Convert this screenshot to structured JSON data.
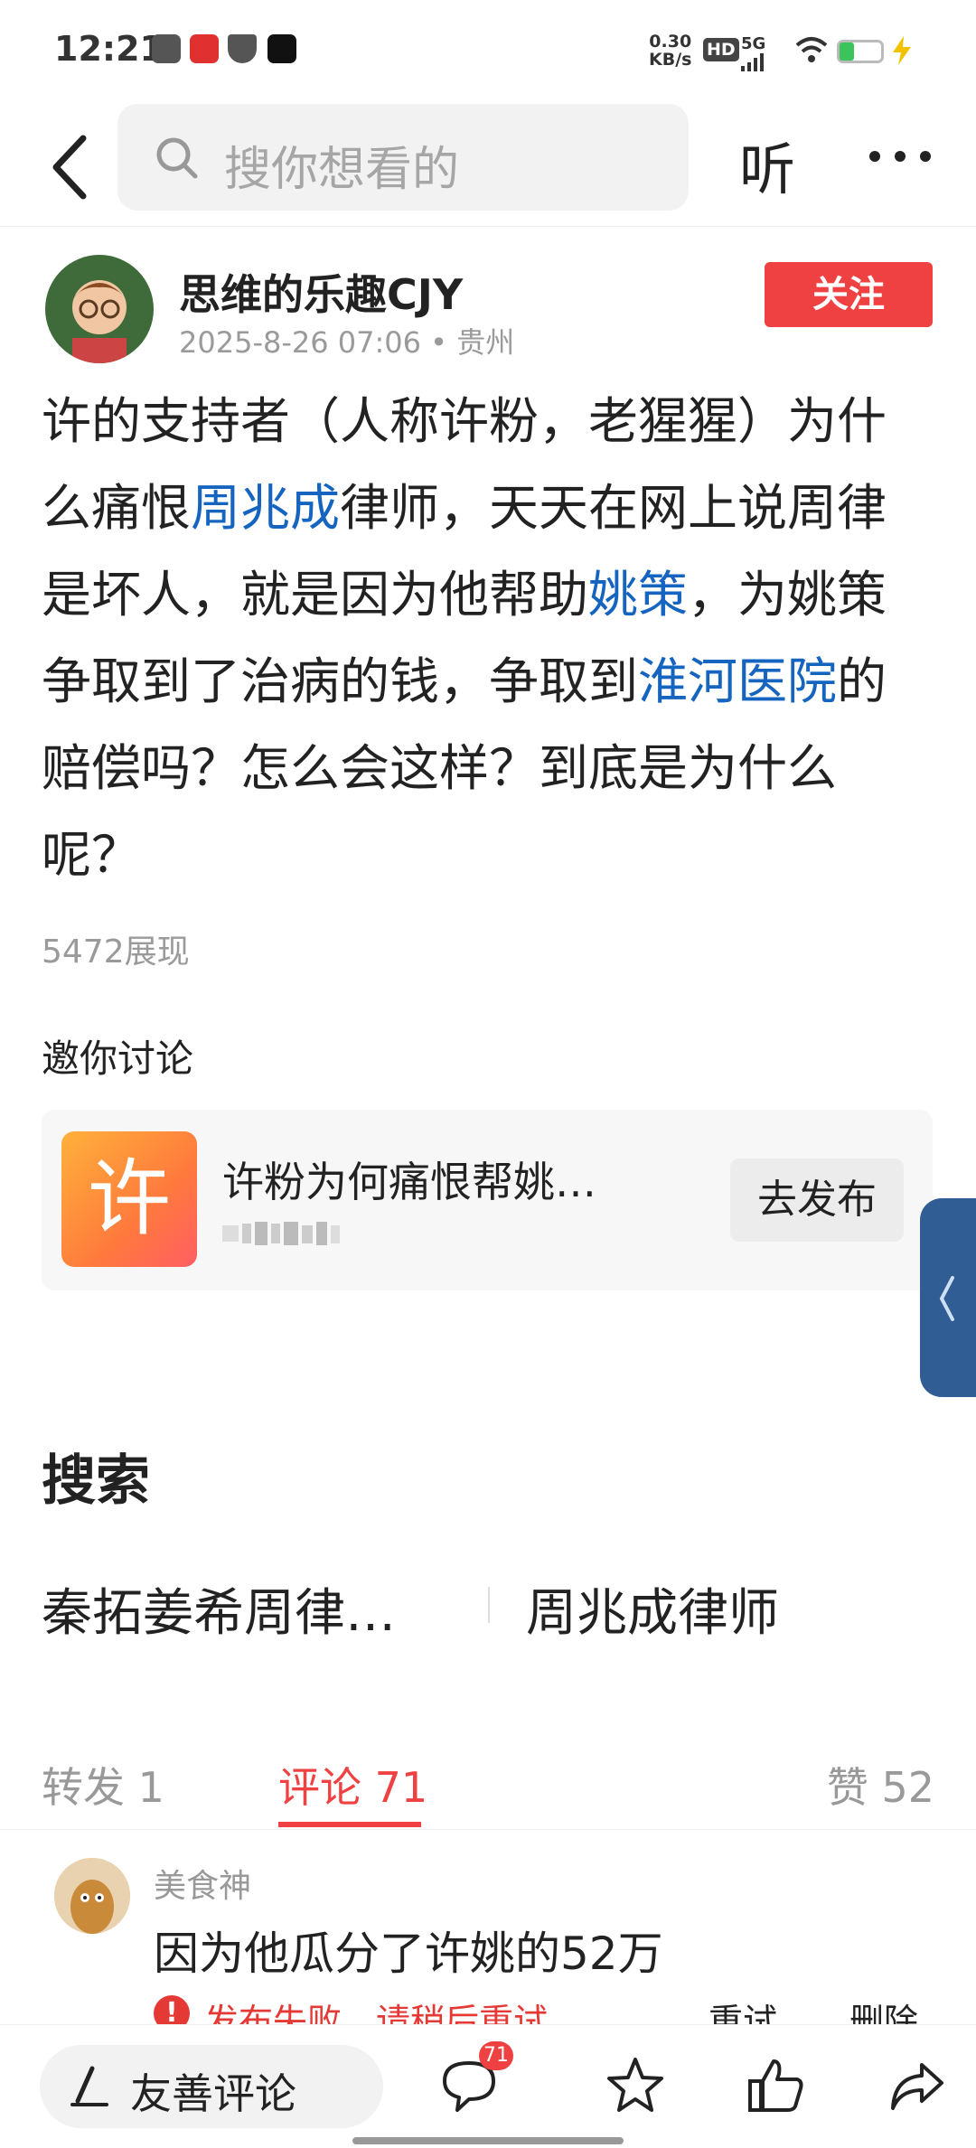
{
  "status_bar": {
    "time": "12:21",
    "net_speed_value": "0.30",
    "net_speed_unit": "KB/s",
    "hd": "HD",
    "signal": "5G",
    "battery_level": 0.35
  },
  "nav": {
    "search_placeholder": "搜你想看的",
    "listen_label": "听"
  },
  "author": {
    "name": "思维的乐趣CJY",
    "meta": "2025-8-26 07:06 • 贵州",
    "follow_label": "关注"
  },
  "post": {
    "body_segments": [
      {
        "text": "许的支持者（人称许粉，老猩猩）为什么痛恨",
        "link": false
      },
      {
        "text": "周兆成",
        "link": true
      },
      {
        "text": "律师，天天在网上说周律是坏人，就是因为他帮助",
        "link": false
      },
      {
        "text": "姚策",
        "link": true
      },
      {
        "text": "，为姚策争取到了治病的钱，争取到",
        "link": false
      },
      {
        "text": "淮河医院",
        "link": true
      },
      {
        "text": "的赔偿吗？怎么会这样？到底是为什么呢？",
        "link": false
      }
    ],
    "views": "5472展现"
  },
  "invite": {
    "title": "邀你讨论",
    "topic_icon_char": "许",
    "topic_title": "许粉为何痛恨帮姚…",
    "publish_label": "去发布"
  },
  "search_section": {
    "title": "搜索",
    "terms": [
      "秦拓姜希周律…",
      "周兆成律师"
    ]
  },
  "tabs": {
    "repost": "转发 1",
    "comments": "评论 71",
    "likes": "赞 52"
  },
  "comment": {
    "user": "美食神",
    "text": "因为他瓜分了许姚的52万",
    "error": "发布失败，请稍后重试",
    "retry": "重试",
    "delete": "删除"
  },
  "bottom_bar": {
    "comment_placeholder": "友善评论",
    "comment_count": "71"
  },
  "colors": {
    "accent": "#f04142",
    "link": "#1565c0",
    "side_tab": "#2f5d94"
  },
  "icons": [
    "back-icon",
    "search-icon",
    "more-icon",
    "error-icon",
    "pen-icon",
    "comment-icon",
    "star-icon",
    "like-icon",
    "share-icon",
    "chevron-left-icon"
  ]
}
